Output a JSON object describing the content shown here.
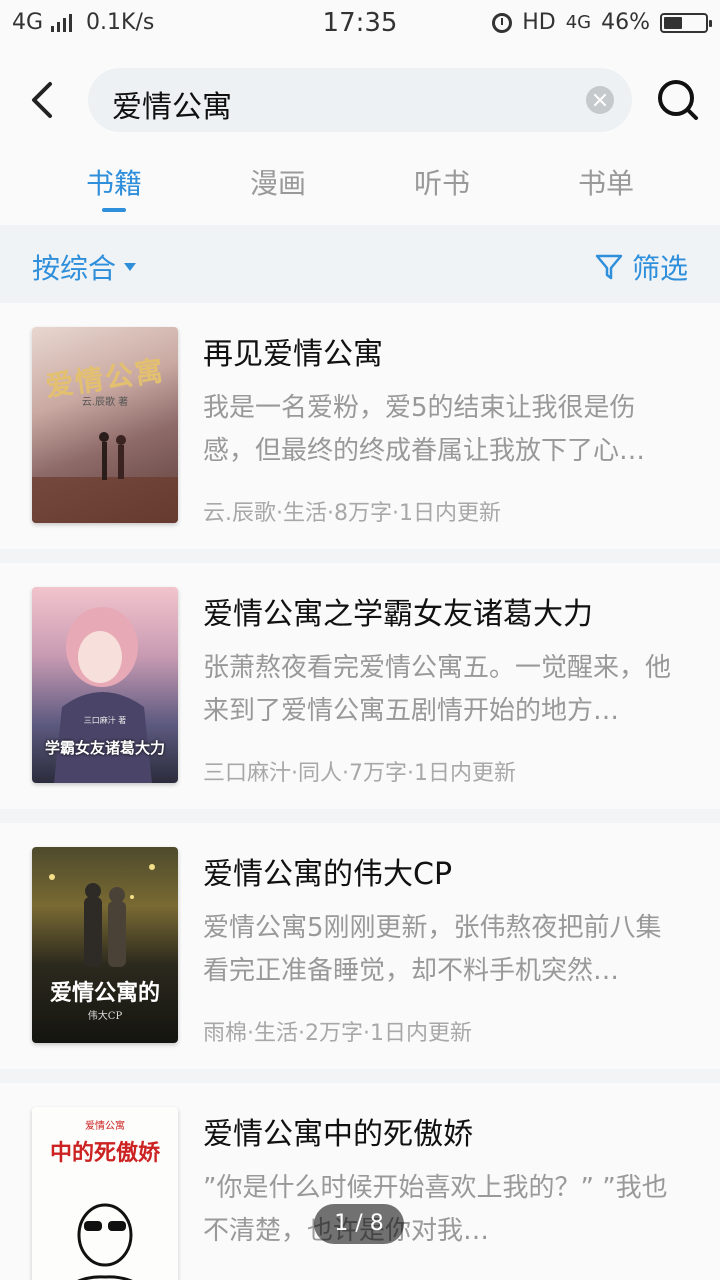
{
  "status_bar": {
    "network": "4G",
    "speed": "0.1K/s",
    "time": "17:35",
    "hd": "HD",
    "network_right": "4G",
    "battery": "46%",
    "battery_level": 0.46
  },
  "search": {
    "query": "爱情公寓"
  },
  "tabs": [
    {
      "label": "书籍",
      "active": true
    },
    {
      "label": "漫画",
      "active": false
    },
    {
      "label": "听书",
      "active": false
    },
    {
      "label": "书单",
      "active": false
    }
  ],
  "filters": {
    "sort_label": "按综合",
    "filter_label": "筛选"
  },
  "books": [
    {
      "title": "再见爱情公寓",
      "description": "我是一名爱粉，爱5的结束让我很是伤感，但最终的终成眷属让我放下了心…",
      "meta": "云.辰歌·生活·8万字·1日内更新",
      "cover_title": "爱情公寓",
      "cover_author": "云.辰歌 著"
    },
    {
      "title": "爱情公寓之学霸女友诸葛大力",
      "description": "张萧熬夜看完爱情公寓五。一觉醒来，他来到了爱情公寓五剧情开始的地方…",
      "meta": "三口麻汁·同人·7万字·1日内更新",
      "cover_title": "学霸女友诸葛大力",
      "cover_author": "三口麻汁 著"
    },
    {
      "title": "爱情公寓的伟大CP",
      "description": "爱情公寓5刚刚更新，张伟熬夜把前八集看完正准备睡觉，却不料手机突然…",
      "meta": "雨棉·生活·2万字·1日内更新",
      "cover_title": "爱情公寓的",
      "cover_author": "伟大CP"
    },
    {
      "title": "爱情公寓中的死傲娇",
      "description": "”你是什么时候开始喜欢上我的？” ”我也不清楚，也许是你对我…",
      "meta": "",
      "cover_title": "中的死傲娇",
      "cover_author": "爱情公寓"
    }
  ],
  "pagination": "1 / 8",
  "colors": {
    "accent": "#2f8fdb",
    "background": "#f2f4f6"
  }
}
